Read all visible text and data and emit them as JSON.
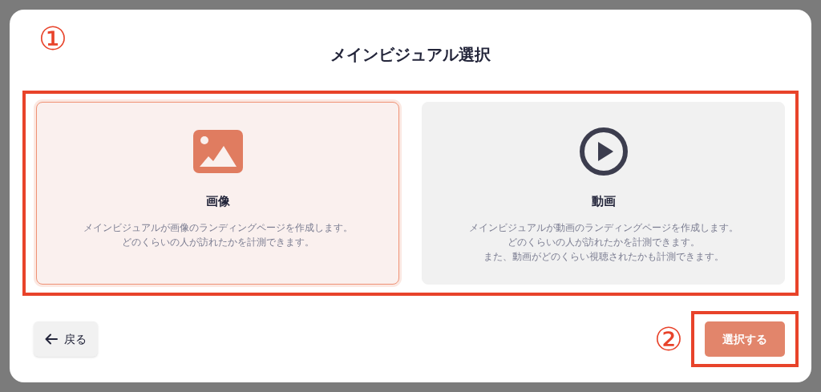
{
  "dialog": {
    "title": "メインビジュアル選択"
  },
  "annotations": [
    {
      "label": "①"
    },
    {
      "label": "②"
    }
  ],
  "cards": [
    {
      "kind": "image",
      "title": "画像",
      "selected": true,
      "description": [
        "メインビジュアルが画像のランディングページを作成します。",
        "どのくらいの人が訪れたかを計測できます。"
      ]
    },
    {
      "kind": "video",
      "title": "動画",
      "selected": false,
      "description": [
        "メインビジュアルが動画のランディングページを作成します。",
        "どのくらいの人が訪れたかを計測できます。",
        "また、動画がどのくらい視聴されたかも計測できます。"
      ]
    }
  ],
  "back_button": {
    "label": "戻る"
  },
  "select_button": {
    "label": "選択する"
  }
}
